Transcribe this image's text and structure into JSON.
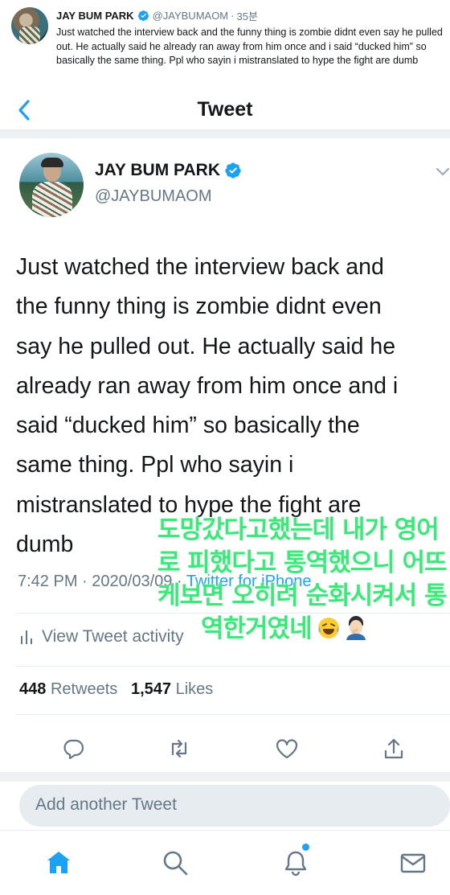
{
  "outer_post": {
    "name": "JAY BUM PARK",
    "handle": "@JAYBUMAOM",
    "separator": "·",
    "time": "35분",
    "text": "Just watched the interview back and the funny thing is zombie didnt even say he pulled out. He actually said he already ran away from him once and i said “ducked him” so basically the same thing. Ppl who sayin i mistranslated to hype the fight are dumb"
  },
  "nav": {
    "title": "Tweet"
  },
  "tweet": {
    "name": "JAY BUM PARK",
    "handle": "@JAYBUMAOM",
    "text_lines": [
      "Just watched the interview back and",
      "the funny thing is zombie didnt even",
      "say he pulled out. He actually said he",
      "already ran away from him once and i",
      "said “ducked him” so basically the",
      "same thing. Ppl who sayin i",
      "mistranslated to hype the fight are",
      "dumb"
    ],
    "time": "7:42 PM",
    "date": "2020/03/09",
    "dot": "·",
    "source": "Twitter for iPhone",
    "activity_label": "View Tweet activity",
    "retweets_count": "448",
    "retweets_label": "Retweets",
    "likes_count": "1,547",
    "likes_label": "Likes"
  },
  "reply": {
    "placeholder": "Add another Tweet"
  },
  "overlay_caption": {
    "lines": [
      "도망갔다고했는데 내가 영어",
      "로 피했다고 통역했으니 어뜨",
      "케보면 오히려 순화시켜서 통",
      "역한거였네"
    ],
    "emojis": [
      "laughing-tears-emoji",
      "facepalm-person-emoji"
    ]
  },
  "colors": {
    "accent": "#1da1f2",
    "muted": "#657786",
    "overlay_text": "#3de87a"
  },
  "icons": [
    "verified-badge-icon",
    "back-chevron-icon",
    "caret-down-icon",
    "bar-chart-icon",
    "reply-icon",
    "retweet-icon",
    "like-icon",
    "share-icon",
    "home-icon",
    "search-icon",
    "notifications-icon",
    "messages-icon"
  ]
}
